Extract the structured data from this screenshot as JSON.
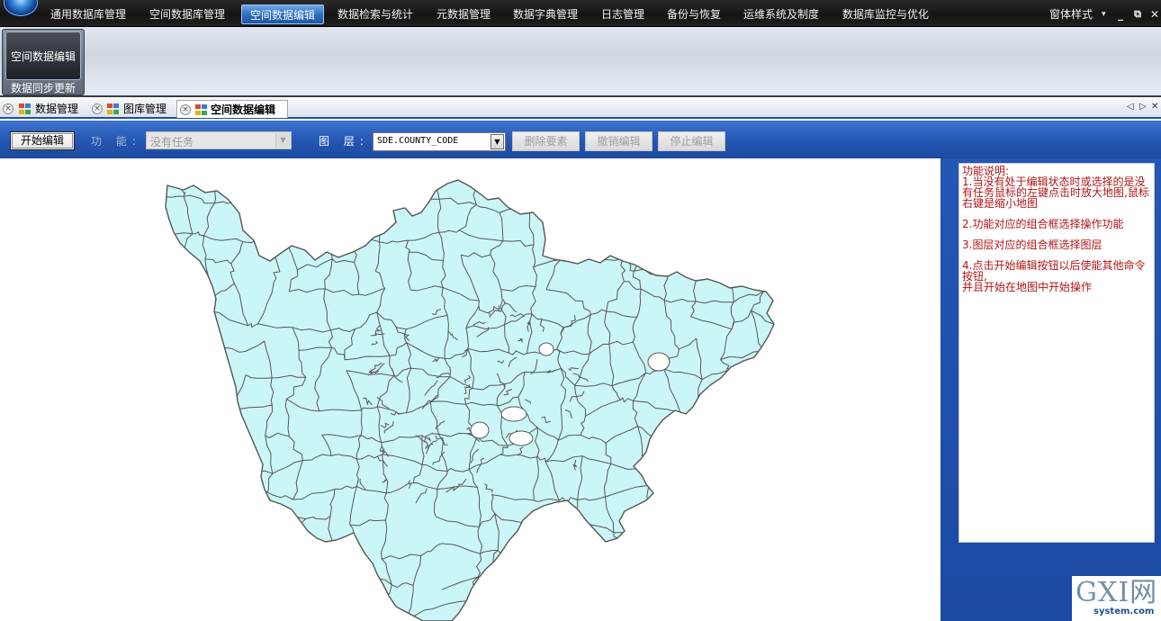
{
  "menubar": {
    "items": [
      {
        "label": "通用数据库管理",
        "active": false
      },
      {
        "label": "空间数据库管理",
        "active": false
      },
      {
        "label": "空间数据编辑",
        "active": true
      },
      {
        "label": "数据检索与统计",
        "active": false
      },
      {
        "label": "元数据管理",
        "active": false
      },
      {
        "label": "数据字典管理",
        "active": false
      },
      {
        "label": "日志管理",
        "active": false
      },
      {
        "label": "备份与恢复",
        "active": false
      },
      {
        "label": "运维系统及制度",
        "active": false
      },
      {
        "label": "数据库监控与优化",
        "active": false
      }
    ],
    "window_style_label": "窗体样式",
    "window_style_arrow": "▾",
    "minimize": "_",
    "restore": "⧉",
    "close": "✕"
  },
  "ribbon": {
    "button_label": "空间数据编辑",
    "group_label": "数据同步更新"
  },
  "tabs": {
    "items": [
      {
        "label": "数据管理",
        "active": false
      },
      {
        "label": "图库管理",
        "active": false
      },
      {
        "label": "空间数据编辑",
        "active": true
      }
    ],
    "close_glyph": "×",
    "nav_prev": "◁",
    "nav_next": "▷",
    "nav_close": "✕"
  },
  "toolbar": {
    "start_edit_label": "开始编辑",
    "function_label": "功 能:",
    "function_value": "没有任务",
    "layer_label": "图 层:",
    "layer_value": "SDE.COUNTY_CODE",
    "delete_feature_label": "删除要素",
    "undo_edit_label": "撤销编辑",
    "stop_edit_label": "停止编辑"
  },
  "help_panel": {
    "title": "功能说明:",
    "item1": "1.当没有处于编辑状态时或选择的是没有任务鼠标的左键点击时放大地图,鼠标右键是缩小地图",
    "item2": "2.功能对应的组合框选择操作功能",
    "item3": "3.图层对应的组合框选择图层",
    "item4a": "4.点击开始编辑按钮以后使能其他命令按钮,",
    "item4b": "并且开始在地图中开始操作"
  },
  "map": {
    "fill_color": "#cbf6f8",
    "stroke_color": "#555555"
  },
  "watermark": {
    "text": "GXI网",
    "sub": "system.com"
  },
  "colors": {
    "toolbar_blue": "#2558b5",
    "help_text_red": "#b21414",
    "menubar_dark": "#1a1a1a"
  }
}
